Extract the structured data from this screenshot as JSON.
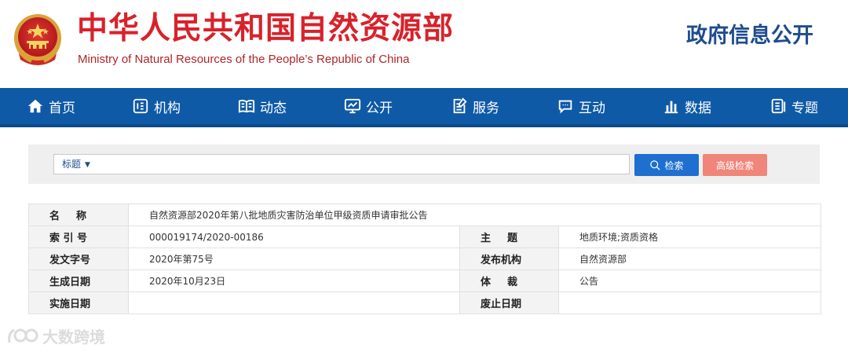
{
  "header": {
    "title_cn": "中华人民共和国自然资源部",
    "title_en": "Ministry of Natural Resources of the People’s Republic of China",
    "section_title": "政府信息公开"
  },
  "nav": {
    "items": [
      {
        "label": "首页",
        "icon": "home-icon"
      },
      {
        "label": "机构",
        "icon": "organization-icon"
      },
      {
        "label": "动态",
        "icon": "book-icon"
      },
      {
        "label": "公开",
        "icon": "monitor-icon"
      },
      {
        "label": "服务",
        "icon": "document-edit-icon"
      },
      {
        "label": "互动",
        "icon": "chat-icon"
      },
      {
        "label": "数据",
        "icon": "bar-chart-icon"
      },
      {
        "label": "专题",
        "icon": "topic-icon"
      }
    ]
  },
  "search": {
    "field_select": "标题",
    "value": "",
    "search_label": "检索",
    "advanced_label": "高级检索"
  },
  "info": {
    "name_label": "名  称",
    "name_value": "自然资源部2020年第八批地质灾害防治单位甲级资质申请审批公告",
    "index_label": "索 引 号",
    "index_value": "000019174/2020-00186",
    "subject_label": "主  题",
    "subject_value": "地质环境;资质资格",
    "doc_no_label": "发文字号",
    "doc_no_value": "2020年第75号",
    "issuer_label": "发布机构",
    "issuer_value": "自然资源部",
    "created_label": "生成日期",
    "created_value": "2020年10月23日",
    "genre_label": "体  裁",
    "genre_value": "公告",
    "effective_label": "实施日期",
    "effective_value": "",
    "expiry_label": "废止日期",
    "expiry_value": ""
  },
  "watermark": {
    "text": "大数跨境"
  },
  "colors": {
    "title_red": "#d8222b",
    "nav_blue": "#0f5aa6",
    "section_blue": "#1e4c8f",
    "search_button": "#1e6fd0",
    "advanced_button": "#f0857a"
  }
}
